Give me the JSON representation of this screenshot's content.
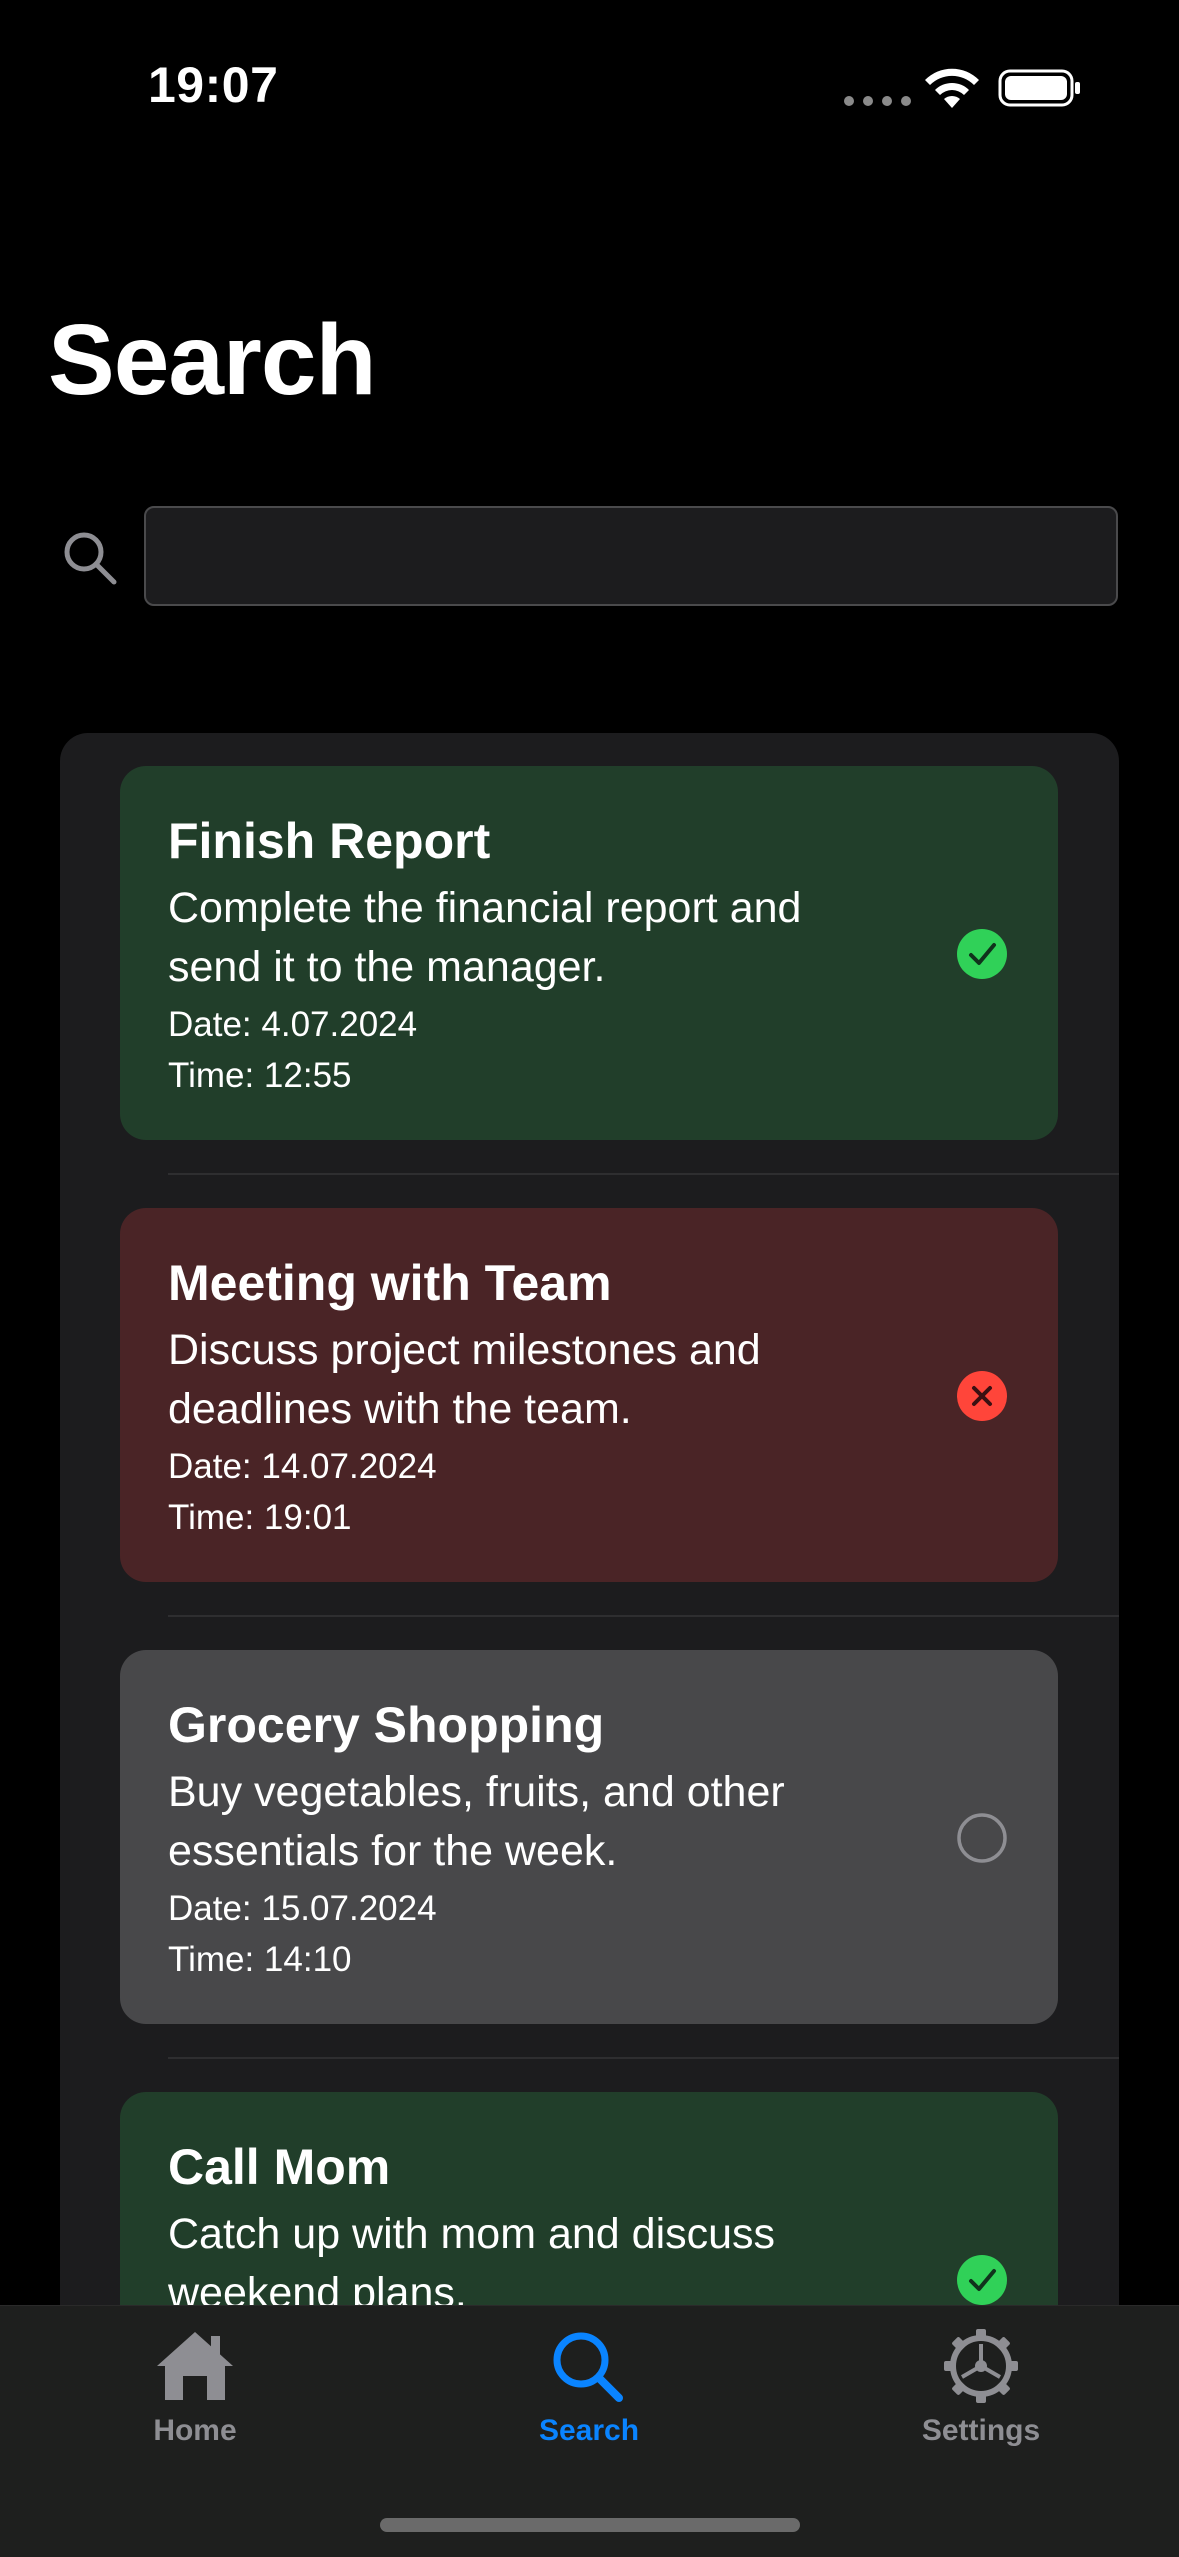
{
  "status_bar": {
    "time": "19:07"
  },
  "page": {
    "title": "Search"
  },
  "search": {
    "value": "",
    "placeholder": ""
  },
  "tasks": [
    {
      "title": "Finish Report",
      "description": "Complete the financial report and send it to the manager.",
      "date": "Date: 4.07.2024",
      "time": "Time: 12:55",
      "status": "completed",
      "status_icon": "checkmark-circle-icon",
      "card_color": "#213e2a",
      "status_color": "#30d158"
    },
    {
      "title": "Meeting with Team",
      "description": "Discuss project milestones and deadlines with the team.",
      "date": "Date: 14.07.2024",
      "time": "Time: 19:01",
      "status": "failed",
      "status_icon": "xmark-circle-icon",
      "card_color": "#4a2426",
      "status_color": "#ff453a"
    },
    {
      "title": "Grocery Shopping",
      "description": "Buy vegetables, fruits, and other essentials for the week.",
      "date": "Date: 15.07.2024",
      "time": "Time: 14:10",
      "status": "pending",
      "status_icon": "empty-circle-icon",
      "card_color": "#48484a",
      "status_color": "#8e8e93"
    },
    {
      "title": "Call Mom",
      "description": "Catch up with mom and discuss weekend plans.",
      "date": "",
      "time": "",
      "status": "completed",
      "status_icon": "checkmark-circle-icon",
      "card_color": "#213e2a",
      "status_color": "#30d158"
    }
  ],
  "tab_bar": {
    "active_color": "#0a84ff",
    "inactive_color": "#8e8e93",
    "items": [
      {
        "label": "Home",
        "icon": "house-icon",
        "active": false
      },
      {
        "label": "Search",
        "icon": "magnifyingglass-icon",
        "active": true
      },
      {
        "label": "Settings",
        "icon": "gear-icon",
        "active": false
      }
    ]
  }
}
